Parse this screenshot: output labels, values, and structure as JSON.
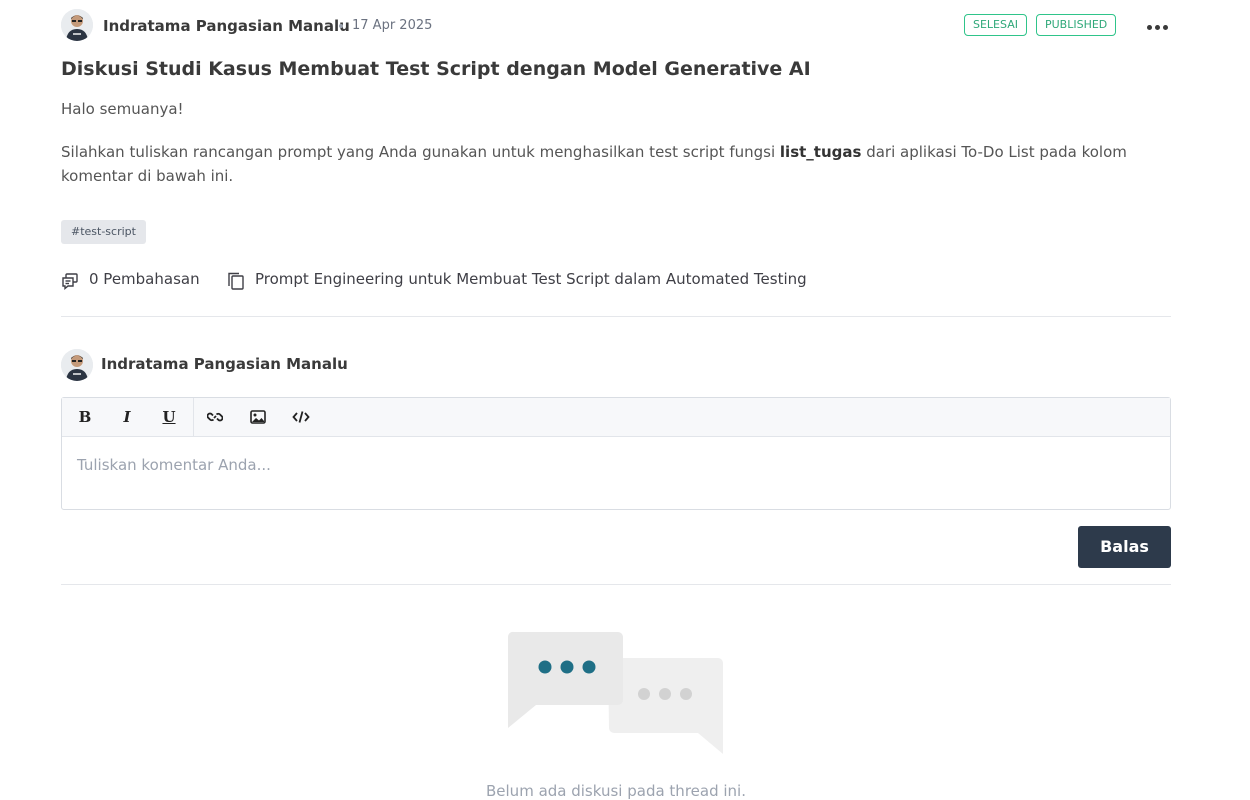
{
  "post": {
    "author": "Indratama Pangasian Manalu",
    "date": "17 Apr 2025",
    "badges": {
      "status": "SELESAI",
      "publish": "PUBLISHED"
    },
    "title": "Diskusi Studi Kasus Membuat Test Script dengan Model Generative AI",
    "greeting": "Halo semuanya!",
    "body_before": "Silahkan tuliskan rancangan prompt yang Anda gunakan untuk menghasilkan test script fungsi ",
    "body_bold": "list_tugas",
    "body_after": " dari aplikasi To-Do List pada kolom komentar di bawah ini.",
    "tag": "#test-script",
    "discussion_count": "0 Pembahasan",
    "course": "Prompt Engineering untuk Membuat Test Script dalam Automated Testing"
  },
  "comment_form": {
    "author": "Indratama Pangasian Manalu",
    "placeholder": "Tuliskan komentar Anda...",
    "toolbar": {
      "bold": "B",
      "italic": "I",
      "underline": "U"
    },
    "reply_label": "Balas"
  },
  "empty_state": {
    "message": "Belum ada diskusi pada thread ini."
  },
  "colors": {
    "badge_green": "#2fc48a",
    "button_dark": "#2d3a4b",
    "dots_teal": "#1f6f86"
  }
}
